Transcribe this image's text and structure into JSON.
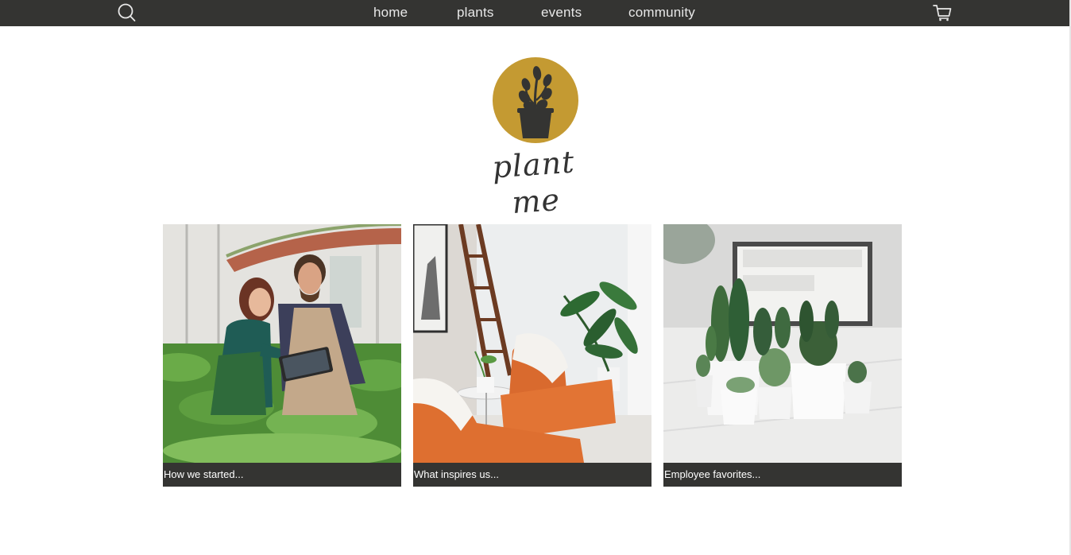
{
  "nav": {
    "search_icon": "search-icon",
    "cart_icon": "cart-icon",
    "links": [
      {
        "label": "home"
      },
      {
        "label": "plants"
      },
      {
        "label": "events"
      },
      {
        "label": "community"
      }
    ]
  },
  "brand": {
    "name": "plant me",
    "accent_color": "#c49a32",
    "dark_color": "#343432"
  },
  "cards": [
    {
      "caption": "How we started...",
      "image": "greenhouse-photo"
    },
    {
      "caption": "What inspires us...",
      "image": "living-room-photo"
    },
    {
      "caption": "Employee favorites...",
      "image": "cactus-photo"
    }
  ]
}
